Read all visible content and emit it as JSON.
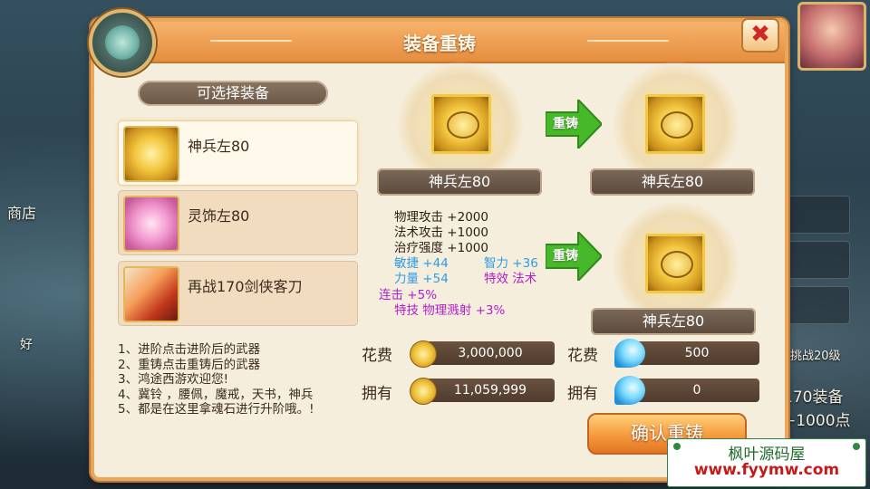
{
  "background": {
    "shop_label": "商店",
    "right_text_1": "170装备",
    "right_text_2": "+1000点",
    "right_text_3": "挑战20级",
    "left_text": "好"
  },
  "panel": {
    "title": "装备重铸",
    "close_icon": "x-close-icon"
  },
  "equipment_list": {
    "header": "可选择装备",
    "items": [
      {
        "label": "神兵左80",
        "icon": "gold-token-icon",
        "selected": true
      },
      {
        "label": "灵饰左80",
        "icon": "pink-ornament-icon",
        "selected": false
      },
      {
        "label": "再战170剑侠客刀",
        "icon": "flame-sword-icon",
        "selected": false
      }
    ]
  },
  "instructions": [
    "1、进阶点击进阶后的武器",
    "2、重铸点击重铸后的武器",
    "3、鸿途西游欢迎您!",
    "4、冀铃 ，腰佩，魔戒，天书，神兵",
    "5、都是在这里拿魂石进行升阶哦。!"
  ],
  "source_item": {
    "name": "神兵左80"
  },
  "result_item_1": {
    "name": "神兵左80"
  },
  "result_item_2": {
    "name": "神兵左80"
  },
  "arrow_label_1": "重铸",
  "arrow_label_2": "重铸",
  "stats": {
    "physical_attack": "物理攻击  +2000",
    "magic_attack": "法术攻击  +1000",
    "healing": "治疗强度  +1000",
    "agility": "敏捷  +44",
    "intelligence": "智力  +36",
    "strength": "力量  +54",
    "special_effect": "特效  法术",
    "combo": "连击  +5%",
    "skill": "特技  物理溅射  +3%"
  },
  "costs": {
    "cost_label": "花费",
    "own_label": "拥有",
    "gold_cost": "3,000,000",
    "gold_owned": "11,059,999",
    "soul_cost": "500",
    "soul_owned": "0"
  },
  "confirm_button": "确认重铸",
  "watermark": {
    "line1": "枫叶源码屋",
    "line2": "www.fyymw.com"
  },
  "colors": {
    "panel_border": "#e8a85b",
    "title_bar": "#e58d3f",
    "stat_blue": "#2e9be6",
    "stat_purple": "#b01ec8",
    "arrow_green": "#46b82a"
  }
}
